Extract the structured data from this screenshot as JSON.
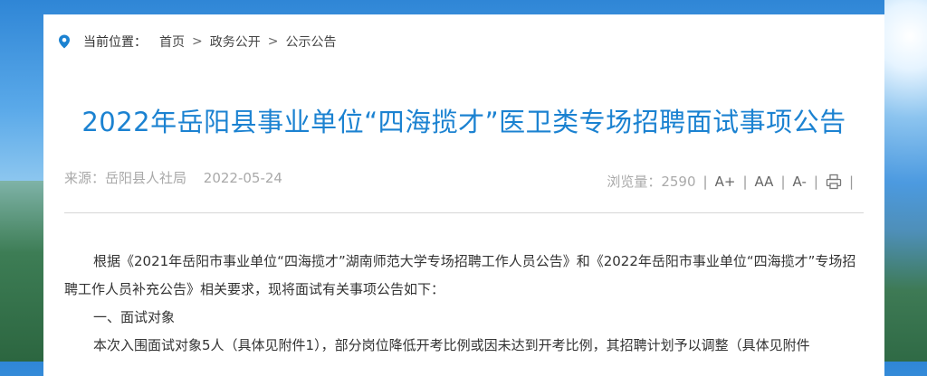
{
  "breadcrumb": {
    "label": "当前位置：",
    "items": [
      "首页",
      "政务公开",
      "公示公告"
    ],
    "separator": ">"
  },
  "article": {
    "title": "2022年岳阳县事业单位“四海揽才”医卫类专场招聘面试事项公告",
    "source": "来源：岳阳县人社局",
    "date": "2022-05-24",
    "views_label": "浏览量：",
    "views": "2590",
    "paragraphs": [
      "根据《2021年岳阳市事业单位“四海揽才”湖南师范大学专场招聘工作人员公告》和《2022年岳阳市事业单位“四海揽才”专场招聘工作人员补充公告》相关要求，现将面试有关事项公告如下：",
      "一、面试对象",
      "本次入围面试对象5人（具体见附件1），部分岗位降低开考比例或因未达到开考比例，其招聘计划予以调整（具体见附件"
    ]
  },
  "tools": {
    "font_increase": "A+",
    "font_normal": "AA",
    "font_decrease": "A-",
    "separator": "|"
  },
  "colors": {
    "title": "#1b82d1",
    "meta": "#a9a9a9",
    "pin": "#1b82d1"
  }
}
